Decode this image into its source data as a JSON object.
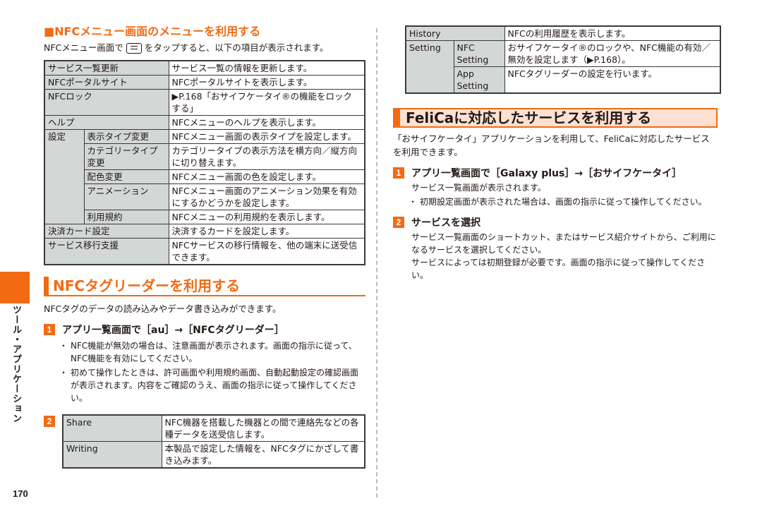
{
  "page": {
    "number": "170",
    "side_label": "ツール・アプリケーション",
    "accent_color": "#f26a12"
  },
  "nfc_menu": {
    "heading": "■NFCメニュー画面のメニューを利用する",
    "intro_before": "NFCメニュー画面で",
    "icon": "menu-key-icon",
    "intro_after": "をタップすると、以下の項目が表示されます。",
    "rows": [
      {
        "key": "サービス一覧更新",
        "value": "サービス一覧の情報を更新します。"
      },
      {
        "key": "NFCポータルサイト",
        "value": "NFCポータルサイトを表示します。"
      },
      {
        "key": "NFCロック",
        "value": "▶P.168「おサイフケータイ®の機能をロックする」"
      },
      {
        "key": "ヘルプ",
        "value": "NFCメニューのヘルプを表示します。"
      },
      {
        "key": "設定",
        "subrows": [
          {
            "key": "表示タイプ変更",
            "value": "NFCメニュー画面の表示タイプを設定します。"
          },
          {
            "key": "カテゴリータイプ変更",
            "value": "カテゴリータイプの表示方法を横方向／縦方向に切り替えます。"
          },
          {
            "key": "配色変更",
            "value": "NFCメニュー画面の色を設定します。"
          },
          {
            "key": "アニメーション",
            "value": "NFCメニュー画面のアニメーション効果を有効にするかどうかを設定します。"
          },
          {
            "key": "利用規約",
            "value": "NFCメニューの利用規約を表示します。"
          }
        ]
      },
      {
        "key": "決済カード設定",
        "value": "決済するカードを設定します。"
      },
      {
        "key": "サービス移行支援",
        "value": "NFCサービスの移行情報を、他の端末に送受信できます。"
      }
    ]
  },
  "nfc_tag": {
    "heading": "NFCタグリーダーを利用する",
    "intro": "NFCタグのデータの読み込みやデータ書き込みができます。",
    "step1": {
      "num": "1",
      "title": "アプリ一覧画面で［au］→［NFCタグリーダー］",
      "bullets": [
        "NFC機能が無効の場合は、注意画面が表示されます。画面の指示に従って、NFC機能を有効にしてください。",
        "初めて操作したときは、許可画面や利用規約画面、自動起動設定の確認画面が表示されます。内容をご確認のうえ、画面の指示に従って操作してください。"
      ]
    },
    "step2": {
      "num": "2",
      "rows": [
        {
          "key": "Share",
          "value": "NFC機器を搭載した機器との間で連絡先などの各種データを送受信します。"
        },
        {
          "key": "Writing",
          "value": "本製品で設定した情報を、NFCタグにかざして書き込みます。"
        }
      ]
    },
    "continued_rows": [
      {
        "key": "History",
        "value": "NFCの利用履歴を表示します。"
      },
      {
        "key": "Setting",
        "subrows": [
          {
            "key": "NFC Setting",
            "value": "おサイフケータイ®のロックや、NFC機能の有効／無効を設定します（▶P.168）。"
          },
          {
            "key": "App Setting",
            "value": "NFCタグリーダーの設定を行います。"
          }
        ]
      }
    ]
  },
  "felica": {
    "heading": "FeliCaに対応したサービスを利用する",
    "intro": "「おサイフケータイ」アプリケーションを利用して、FeliCaに対応したサービスを利用できます。",
    "step1": {
      "num": "1",
      "title": "アプリ一覧画面で［Galaxy plus］→［おサイフケータイ］",
      "body": "サービス一覧画面が表示されます。",
      "bullets": [
        "初期設定画面が表示された場合は、画面の指示に従って操作してください。"
      ]
    },
    "step2": {
      "num": "2",
      "title": "サービスを選択",
      "body": [
        "サービス一覧画面のショートカット、またはサービス紹介サイトから、ご利用になるサービスを選択してください。",
        "サービスによっては初期登録が必要です。画面の指示に従って操作してください。"
      ]
    }
  }
}
